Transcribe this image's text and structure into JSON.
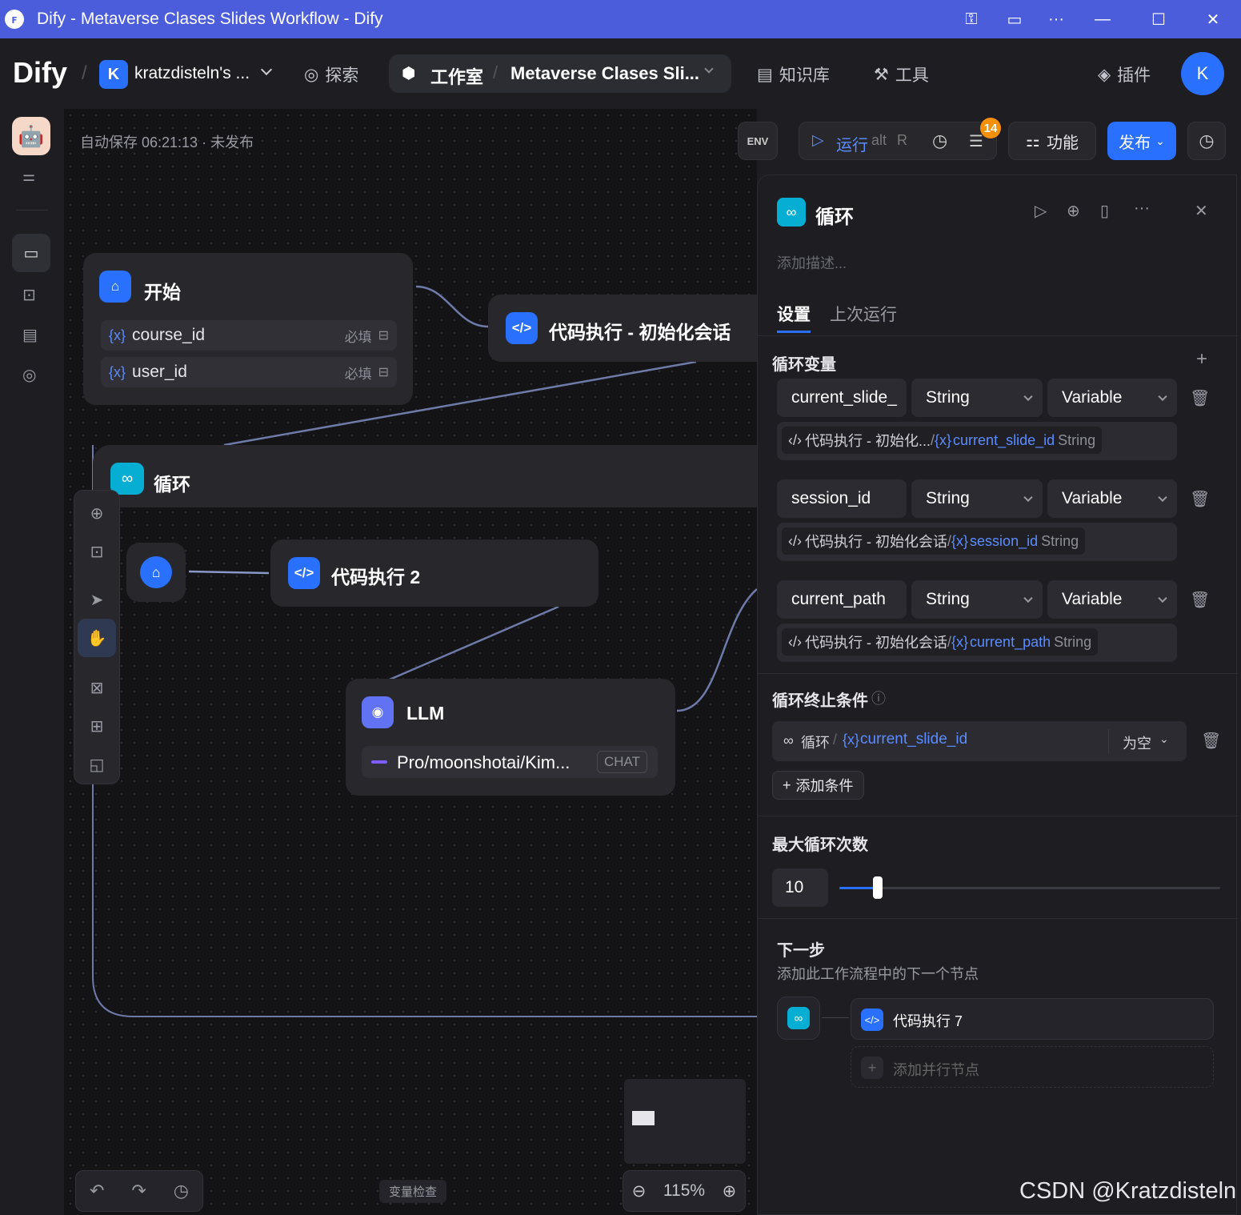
{
  "window": {
    "title": "Dify - Metaverse Clases Slides Workflow - Dify",
    "logo": "ꜰ",
    "controls": [
      "key-icon",
      "cast-icon",
      "more-icon",
      "minimize-icon",
      "maximize-icon",
      "close-icon"
    ]
  },
  "nav": {
    "brand": "Dify",
    "workspace_initial": "K",
    "workspace_name": "kratzdisteln's ...",
    "explore": "探索",
    "studio": "工作室",
    "app_name": "Metaverse Clases Sli...",
    "knowledge": "知识库",
    "tools": "工具",
    "plugins": "插件",
    "avatar_initial": "K"
  },
  "toolbar": {
    "autosave": "自动保存 06:21:13 · 未发布",
    "env": "ENV",
    "run": "运行",
    "run_shortcut_1": "alt",
    "run_shortcut_2": "R",
    "checklist_badge": "14",
    "features": "功能",
    "publish": "发布"
  },
  "nodes": {
    "start": {
      "title": "开始",
      "vars": [
        {
          "name": "course_id",
          "tag": "必填"
        },
        {
          "name": "user_id",
          "tag": "必填"
        }
      ]
    },
    "code_init": {
      "title": "代码执行 - 初始化会话"
    },
    "loop": {
      "title": "循环"
    },
    "code2": {
      "title": "代码执行 2"
    },
    "llm": {
      "title": "LLM",
      "model": "Pro/moonshotai/Kim...",
      "mode": "CHAT"
    }
  },
  "canvas_bottom": {
    "var_inspect": "变量检查",
    "zoom": "115%"
  },
  "panel": {
    "title": "循环",
    "desc_placeholder": "添加描述...",
    "tabs": [
      "设置",
      "上次运行"
    ],
    "loop_vars_title": "循环变量",
    "loop_vars": [
      {
        "name": "current_slide_",
        "type": "String",
        "mode": "Variable",
        "src_node": "代码执行 - 初始化...",
        "src_sep": " / ",
        "src_var": "current_slide_id",
        "src_type": "String"
      },
      {
        "name": "session_id",
        "type": "String",
        "mode": "Variable",
        "src_node": "代码执行 - 初始化会话",
        "src_sep": " / ",
        "src_var": "session_id",
        "src_type": "String"
      },
      {
        "name": "current_path",
        "type": "String",
        "mode": "Variable",
        "src_node": "代码执行 - 初始化会话",
        "src_sep": " / ",
        "src_var": "current_path",
        "src_type": "String"
      }
    ],
    "break_title": "循环终止条件",
    "condition": {
      "node": "循环",
      "var": "current_slide_id",
      "op": "为空"
    },
    "add_condition": "添加条件",
    "max_title": "最大循环次数",
    "max_value": "10",
    "max_fraction": 0.1,
    "next_title": "下一步",
    "next_desc": "添加此工作流程中的下一个节点",
    "next_node": "代码执行 7",
    "add_parallel": "添加并行节点"
  },
  "watermark": "CSDN @Kratzdisteln"
}
